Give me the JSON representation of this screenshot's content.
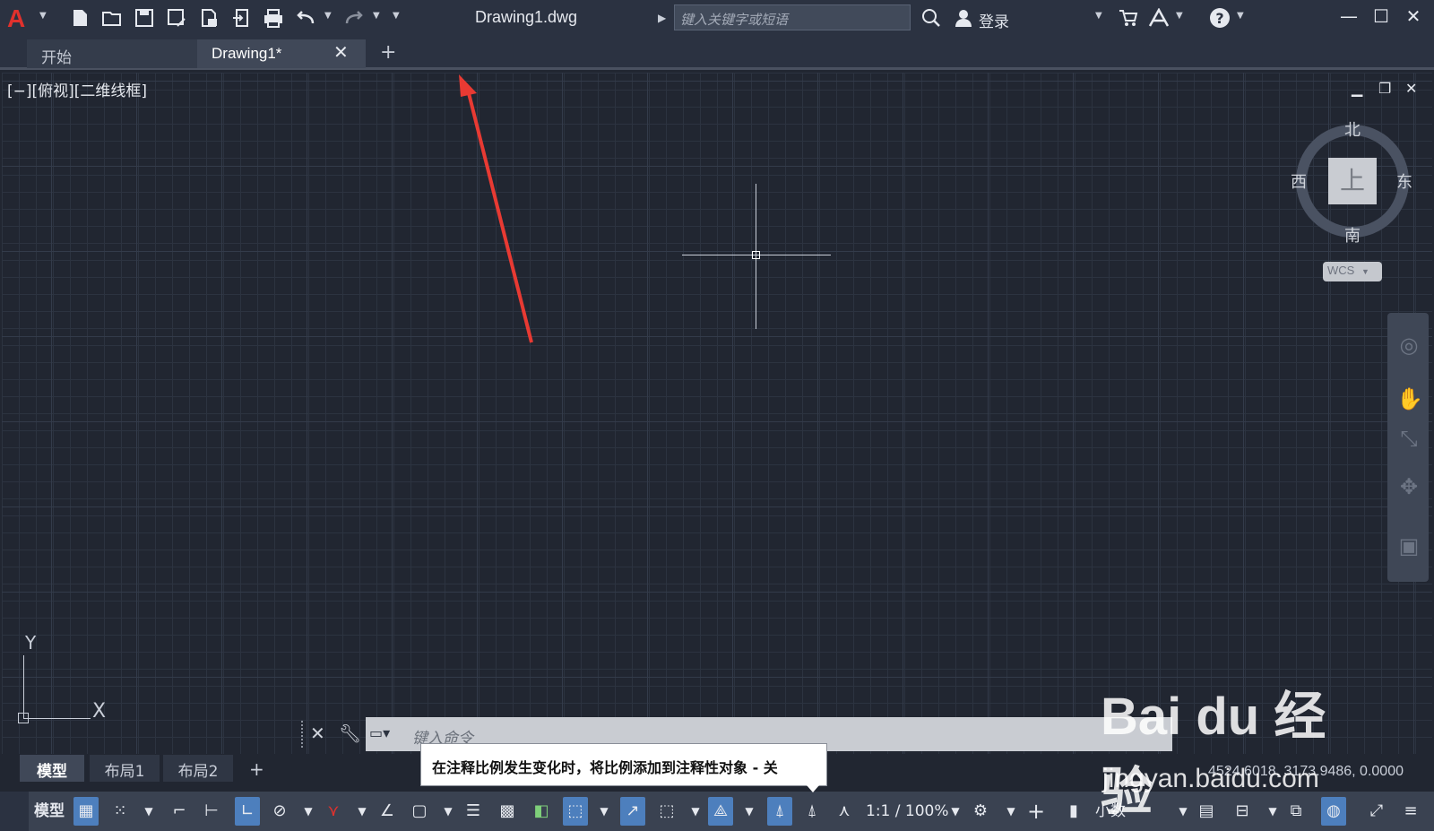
{
  "titlebar": {
    "app_logo": "A",
    "doc_title": "Drawing1.dwg",
    "search_placeholder": "键入关键字或短语",
    "login_label": "登录",
    "quick_access_icons": [
      "new-icon",
      "open-icon",
      "save-icon",
      "save-as-icon",
      "publish-icon",
      "export-icon",
      "print-icon",
      "undo-icon",
      "redo-icon"
    ]
  },
  "tabs": {
    "start": "开始",
    "drawing": "Drawing1*",
    "close": "✕",
    "add": "+"
  },
  "viewport": {
    "label": "[−][俯视][二维线框]",
    "controls": [
      "minimize-icon",
      "restore-icon",
      "close-icon"
    ]
  },
  "viewcube": {
    "north": "北",
    "south": "南",
    "east": "东",
    "west": "西",
    "face": "上",
    "wcs": "WCS"
  },
  "ucs": {
    "x": "X",
    "y": "Y"
  },
  "command": {
    "placeholder": "键入命令"
  },
  "tooltip": {
    "text": "在注释比例发生变化时，将比例添加到注释性对象 - 关"
  },
  "layout_tabs": {
    "model": "模型",
    "layout1": "布局1",
    "layout2": "布局2",
    "add": "+"
  },
  "statusbar": {
    "model_label": "模型",
    "scale": "1:1 / 100%",
    "units": "小数",
    "coords": "4524.6018, 3173.9486, 0.0000"
  },
  "watermark": {
    "brand": "Bai du 经验",
    "url": "jingyan.baidu.com"
  }
}
